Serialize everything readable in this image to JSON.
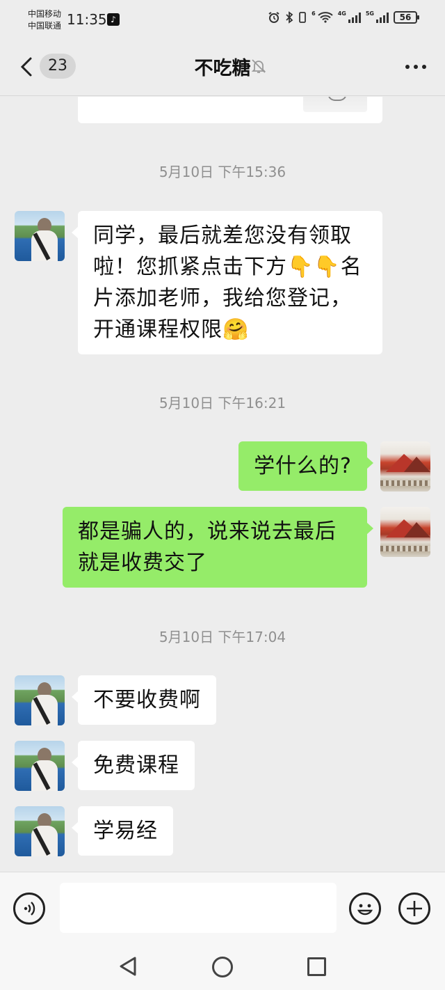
{
  "status_bar": {
    "carrier1": "中国移动",
    "carrier2": "中国联通",
    "time": "11:35",
    "battery": "56",
    "net_tag1": "6",
    "net_tag2": "4G",
    "net_tag3": "5G"
  },
  "header": {
    "unread_count": "23",
    "title": "不吃糖"
  },
  "messages": {
    "ts1": "5月10日 下午15:36",
    "m1": "同学，最后就差您没有领取啦！您抓紧点击下方👇👇名片添加老师，我给您登记，开通课程权限🤗",
    "ts2": "5月10日 下午16:21",
    "m2": "学什么的?",
    "m3": "都是骗人的，说来说去最后就是收费交了",
    "ts3": "5月10日 下午17:04",
    "m4": "不要收费啊",
    "m5": "免费课程",
    "m6": "学易经"
  },
  "colors": {
    "background": "#ededed",
    "bubble_in": "#ffffff",
    "bubble_out": "#95ec69",
    "timestamp": "#8f8f8f"
  },
  "icons": [
    "back-icon",
    "mute-bell-icon",
    "more-icon",
    "voice-icon",
    "emoji-icon",
    "plus-icon",
    "nav-back-icon",
    "nav-home-icon",
    "nav-recent-icon",
    "tiktok-icon",
    "alarm-icon",
    "bluetooth-icon",
    "wifi-icon",
    "signal-icon",
    "battery-icon"
  ]
}
